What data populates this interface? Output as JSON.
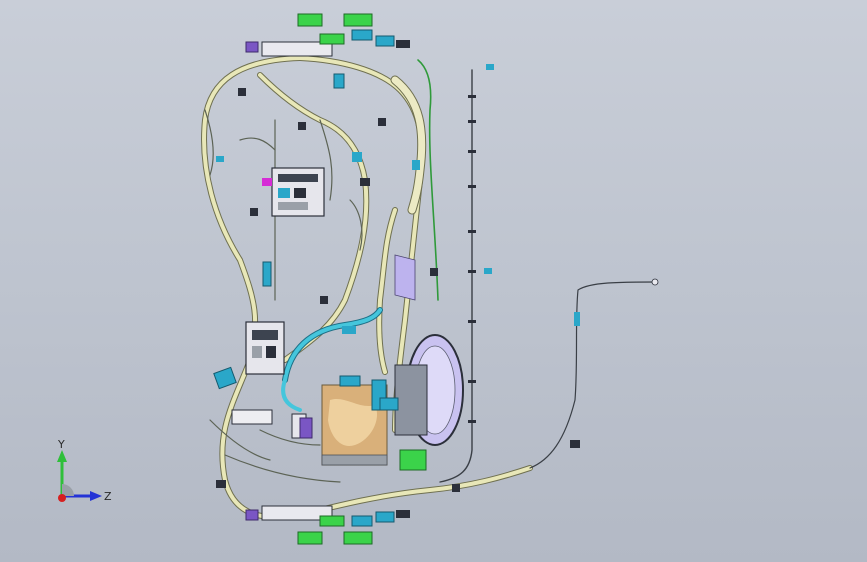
{
  "viewport": {
    "background_top": "#c9ced8",
    "background_bottom": "#b3b9c5"
  },
  "triad": {
    "y_label": "Y",
    "z_label": "Z",
    "y_axis_color": "#2fbf3a",
    "z_axis_color": "#2433d6",
    "origin_color": "#d62020"
  },
  "model": {
    "icon": "wiring-harness-assembly",
    "colors": {
      "harness": "#e8e7b8",
      "harness_edge": "#6f7050",
      "connector_green": "#3bd34a",
      "connector_cyan": "#2aa7c9",
      "connector_purple": "#7a56c4",
      "connector_dark": "#2b2f3a",
      "panel_tan": "#e8c48a",
      "panel_lavender": "#c9c2f0"
    }
  }
}
